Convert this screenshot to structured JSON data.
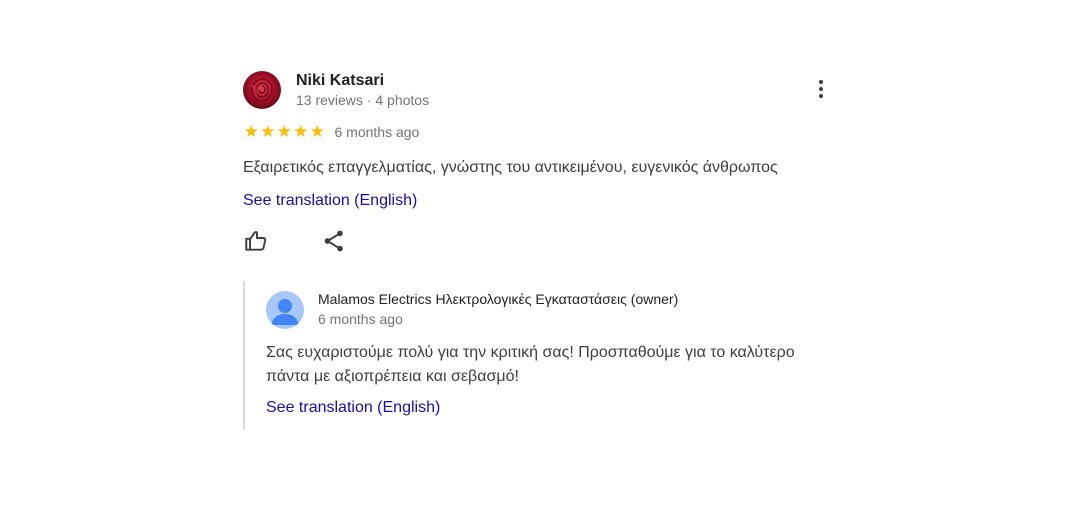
{
  "review": {
    "author": {
      "name": "Niki Katsari",
      "meta": "13 reviews · 4 photos",
      "avatar_icon": "rose-avatar"
    },
    "rating": 5,
    "rating_max": 5,
    "star_color": "#fbbc04",
    "date": "6 months ago",
    "text": "Εξαιρετικός επαγγελματίας, γνώστης του αντικειμένου, ευγενικός άνθρωπος",
    "translate_label": "See translation (English)",
    "actions": {
      "like_icon": "thumbs-up-icon",
      "share_icon": "share-icon",
      "more_icon": "more-vert-icon"
    }
  },
  "owner_reply": {
    "name": "Malamos Electrics Ηλεκτρολογικές Εγκαταστάσεις (owner)",
    "date": "6 months ago",
    "avatar_icon": "person-avatar-icon",
    "text_lines": [
      "Σας ευχαριστούμε πολύ για την κριτική σας! Προσπαθούμε για το καλύτερο",
      "πάντα με αξιοπρέπεια και σεβασμό!"
    ],
    "translate_label": "See translation (English)"
  },
  "colors": {
    "link": "#1a0dab",
    "secondary_text": "#70757a",
    "reply_border": "#dadce0",
    "owner_avatar_bg": "#a8c7fa",
    "owner_avatar_fg": "#4285f4"
  }
}
